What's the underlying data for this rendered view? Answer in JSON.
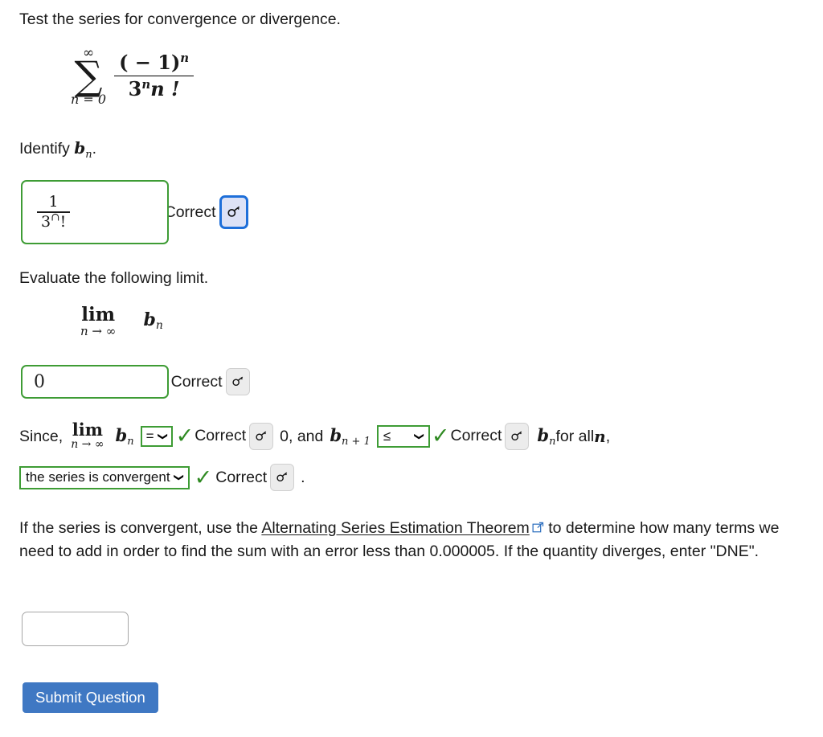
{
  "question": {
    "title": "Test the series for convergence or divergence.",
    "series": {
      "sigma": "∑",
      "upper": "∞",
      "lower": "n = 0",
      "numerator": "( − 1)",
      "numerator_exp": "n",
      "denominator_base": "3",
      "denominator_exp": "n",
      "denominator_tail": "n !"
    },
    "identify_prompt_pre": "Identify ",
    "identify_prompt_var": "b",
    "identify_prompt_sub": "n",
    "identify_prompt_post": "."
  },
  "answer1": {
    "value_numerator": "1",
    "value_denominator_base": "3",
    "value_denominator_exp": "∩",
    "value_denominator_tail": "!",
    "check_glyph": "✓",
    "status": "Correct",
    "key_icon": "key-icon",
    "key_focused": true
  },
  "limit_section": {
    "prompt": "Evaluate the following limit.",
    "lim_operator": "lim",
    "lim_subscript": "n → ∞",
    "lim_body_var": "b",
    "lim_body_sub": "n"
  },
  "answer2": {
    "value": "0",
    "check_glyph": "✓",
    "status": "Correct",
    "key_icon": "key-icon"
  },
  "since_line": {
    "since_text": "Since,",
    "lim_operator": "lim",
    "lim_subscript": "n → ∞",
    "bn_var": "b",
    "bn_sub": "n",
    "select1_value": "=",
    "select1_chevron": "❯",
    "check1_glyph": "✓",
    "correct1": "Correct",
    "key1_icon": "key-icon",
    "mid_text": "0, and",
    "bn1_var": "b",
    "bn1_sub": "n + 1",
    "select2_value": "≤",
    "select2_chevron": "❯",
    "check2_glyph": "✓",
    "correct2": "Correct",
    "key2_icon": "key-icon",
    "bn2_var": "b",
    "bn2_sub": "n",
    "tail_text_pre": " for all ",
    "tail_var": "n",
    "tail_text_post": ","
  },
  "conclusion_line": {
    "select_value": "the series is convergent",
    "select_chevron": "❯",
    "check_glyph": "✓",
    "status": "Correct",
    "key_icon": "key-icon",
    "period": "."
  },
  "instructions": {
    "part1": "If the series is convergent, use the ",
    "link_text": "Alternating Series Estimation Theorem",
    "link_icon": "external-link-icon",
    "part2": " to determine how many terms we need to add in order to find the sum with an error less than 0.000005. If the quantity diverges, enter \"DNE\"."
  },
  "final_answer": {
    "value": "",
    "placeholder": ""
  },
  "submit": {
    "label": "Submit Question"
  },
  "colors": {
    "correct_green": "#3e9c35",
    "check_green": "#2f8a22",
    "focus_blue": "#1e6fd9",
    "focus_fill": "#dde2f6",
    "submit_blue": "#3f78c3",
    "link_icon_blue": "#2d6fbf",
    "text": "#1a1a1a"
  }
}
